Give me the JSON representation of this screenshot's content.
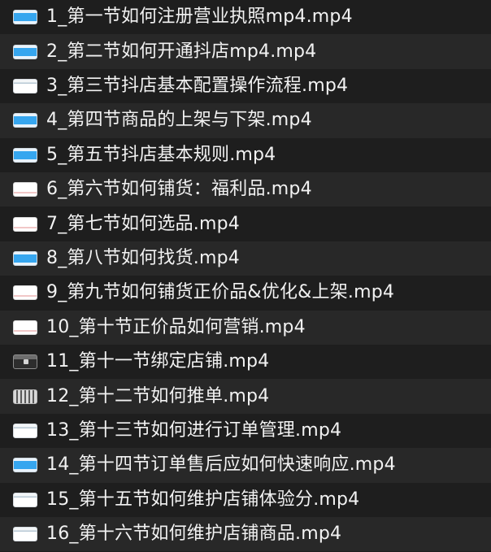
{
  "files": [
    {
      "name": "1_第一节如何注册营业执照mp4.mp4",
      "thumb": "blue-video-thumbnail"
    },
    {
      "name": "2_第二节如何开通抖店mp4.mp4",
      "thumb": "blue-video-thumbnail"
    },
    {
      "name": "3_第三节抖店基本配置操作流程.mp4",
      "thumb": "pale-video-thumbnail"
    },
    {
      "name": "4_第四节商品的上架与下架.mp4",
      "thumb": "blue-video-thumbnail"
    },
    {
      "name": "5_第五节抖店基本规则.mp4",
      "thumb": "blue-video-thumbnail"
    },
    {
      "name": "6_第六节如何铺货：福利品.mp4",
      "thumb": "white-video-thumbnail"
    },
    {
      "name": "7_第七节如何选品.mp4",
      "thumb": "white-video-thumbnail"
    },
    {
      "name": "8_第八节如何找货.mp4",
      "thumb": "blue-video-thumbnail"
    },
    {
      "name": "9_第九节如何铺货正价品&优化&上架.mp4",
      "thumb": "white-video-thumbnail"
    },
    {
      "name": "10_第十节正价品如何营销.mp4",
      "thumb": "white-video-thumbnail"
    },
    {
      "name": "11_第十一节绑定店铺.mp4",
      "thumb": "dark-video-thumbnail"
    },
    {
      "name": "12_第十二节如何推单.mp4",
      "thumb": "grid-video-thumbnail"
    },
    {
      "name": "13_第十三节如何进行订单管理.mp4",
      "thumb": "pale-video-thumbnail"
    },
    {
      "name": "14_第十四节订单售后应如何快速响应.mp4",
      "thumb": "blue-video-thumbnail"
    },
    {
      "name": "15_第十五节如何维护店铺体验分.mp4",
      "thumb": "pale-video-thumbnail"
    },
    {
      "name": "16_第十六节如何维护店铺商品.mp4",
      "thumb": "pale-video-thumbnail"
    }
  ],
  "colors": {
    "background": "#1e1e1e",
    "alternate_row": "#282828",
    "text": "#f2f2f2",
    "accent_blue": "#36a6ef"
  }
}
